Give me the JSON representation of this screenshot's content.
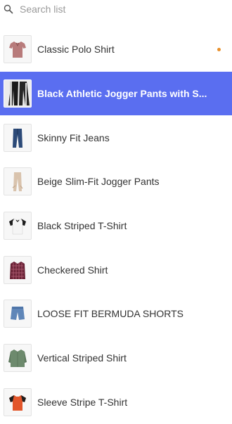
{
  "search": {
    "placeholder": "Search list",
    "value": ""
  },
  "items": [
    {
      "label": "Classic Polo Shirt",
      "icon": "polo-shirt-icon",
      "color": "#b87b7b",
      "selected": false,
      "modified": true
    },
    {
      "label": "Black Athletic Jogger Pants with S...",
      "icon": "jogger-pants-icon",
      "color": "#1a1a1a",
      "selected": true,
      "modified": false
    },
    {
      "label": "Skinny Fit Jeans",
      "icon": "jeans-icon",
      "color": "#2c4a78",
      "selected": false,
      "modified": false
    },
    {
      "label": "Beige Slim-Fit Jogger Pants",
      "icon": "beige-pants-icon",
      "color": "#d9c3ad",
      "selected": false,
      "modified": false
    },
    {
      "label": "Black Striped T-Shirt",
      "icon": "striped-tshirt-icon",
      "color": "#2a2a2a",
      "selected": false,
      "modified": false
    },
    {
      "label": "Checkered Shirt",
      "icon": "checkered-shirt-icon",
      "color": "#6b2438",
      "selected": false,
      "modified": false
    },
    {
      "label": "LOOSE FIT BERMUDA SHORTS",
      "icon": "denim-shorts-icon",
      "color": "#5f86b8",
      "selected": false,
      "modified": false
    },
    {
      "label": "Vertical Striped Shirt",
      "icon": "green-shirt-icon",
      "color": "#6d8a6d",
      "selected": false,
      "modified": false
    },
    {
      "label": "Sleeve Stripe T-Shirt",
      "icon": "orange-tshirt-icon",
      "color": "#e2552a",
      "selected": false,
      "modified": false
    }
  ],
  "colors": {
    "selected_bg": "#5a6ef0",
    "modified_dot": "#e8902a"
  }
}
